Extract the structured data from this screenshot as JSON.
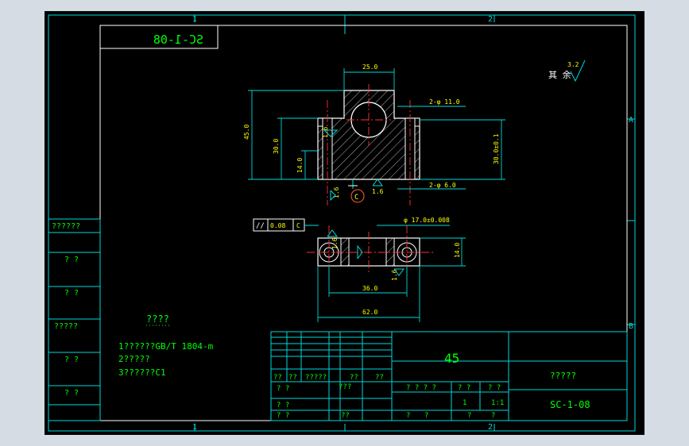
{
  "frame": {
    "zone_top": [
      "1",
      "2"
    ],
    "zone_bottom": [
      "1",
      "2"
    ],
    "zone_right": [
      "A",
      "B"
    ]
  },
  "title_box_mirrored": "SC-1-08",
  "surface_finish": {
    "label": "其 余",
    "value": "3.2"
  },
  "datum_label": "C",
  "dims_front": {
    "top_width": "25.0",
    "height_total": "45.0",
    "height_mid": "30.0",
    "height_low": "14.0",
    "hole_top": "2-φ 11.0",
    "hole_bottom": "2-φ 6.0",
    "hole_spacing": "30.0±0.1",
    "rough_a": "1.6",
    "rough_b": "1.6",
    "rough_c": "1.6"
  },
  "tolerance": {
    "symbol": "//",
    "value": "0.08",
    "datum": "C"
  },
  "dims_top": {
    "bore": "φ 17.0±0.008",
    "thickness": "14.0",
    "spacing": "36.0",
    "length": "62.0",
    "rough_a": "1.6",
    "rough_b": "1.6"
  },
  "left_column": [
    "??????",
    "? ?",
    "? ?",
    "?????",
    "? ?",
    "? ?"
  ],
  "notes": {
    "heading": "????",
    "lines": [
      "1??????GB/T 1804-m",
      "2?????",
      "3??????C1"
    ]
  },
  "title_block": {
    "material": "45",
    "drawing_name": "?????",
    "drawing_no": "SC-1-08",
    "row_labels": [
      "??",
      "??",
      "?????",
      "??",
      "??"
    ],
    "row2": [
      "? ?",
      "???"
    ],
    "row3": [
      "? ?"
    ],
    "row4": [
      "? ?",
      "??"
    ],
    "stage_header": [
      "? ? ? ?",
      "? ?",
      "? ?"
    ],
    "stage_values": [
      "1",
      "1:1"
    ],
    "bottom": [
      "?",
      "?",
      "?",
      "?"
    ]
  }
}
